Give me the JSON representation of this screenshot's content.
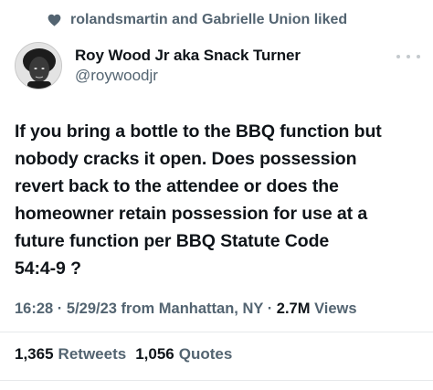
{
  "social_context": {
    "icon": "heart-icon",
    "text": "rolandsmartin and Gabrielle Union liked"
  },
  "author": {
    "display_name": "Roy Wood Jr aka Snack Turner",
    "handle": "@roywoodjr"
  },
  "tweet": {
    "text_lines": [
      "If you bring a bottle to the BBQ function but",
      "nobody cracks it open. Does possession",
      "revert back to the attendee or does the",
      "homeowner retain possession for use at a",
      "future function per BBQ Statute Code",
      "54:4-9 ?"
    ]
  },
  "meta": {
    "time": "16:28",
    "date": "5/29/23",
    "location": "from Manhattan, NY",
    "views_count": "2.7M",
    "views_label": "Views"
  },
  "stats": {
    "retweets_count": "1,365",
    "retweets_label": "Retweets",
    "quotes_count": "1,056",
    "quotes_label": "Quotes"
  },
  "colors": {
    "text": "#0f1419",
    "secondary": "#536471",
    "divider": "#e6e9eb"
  }
}
